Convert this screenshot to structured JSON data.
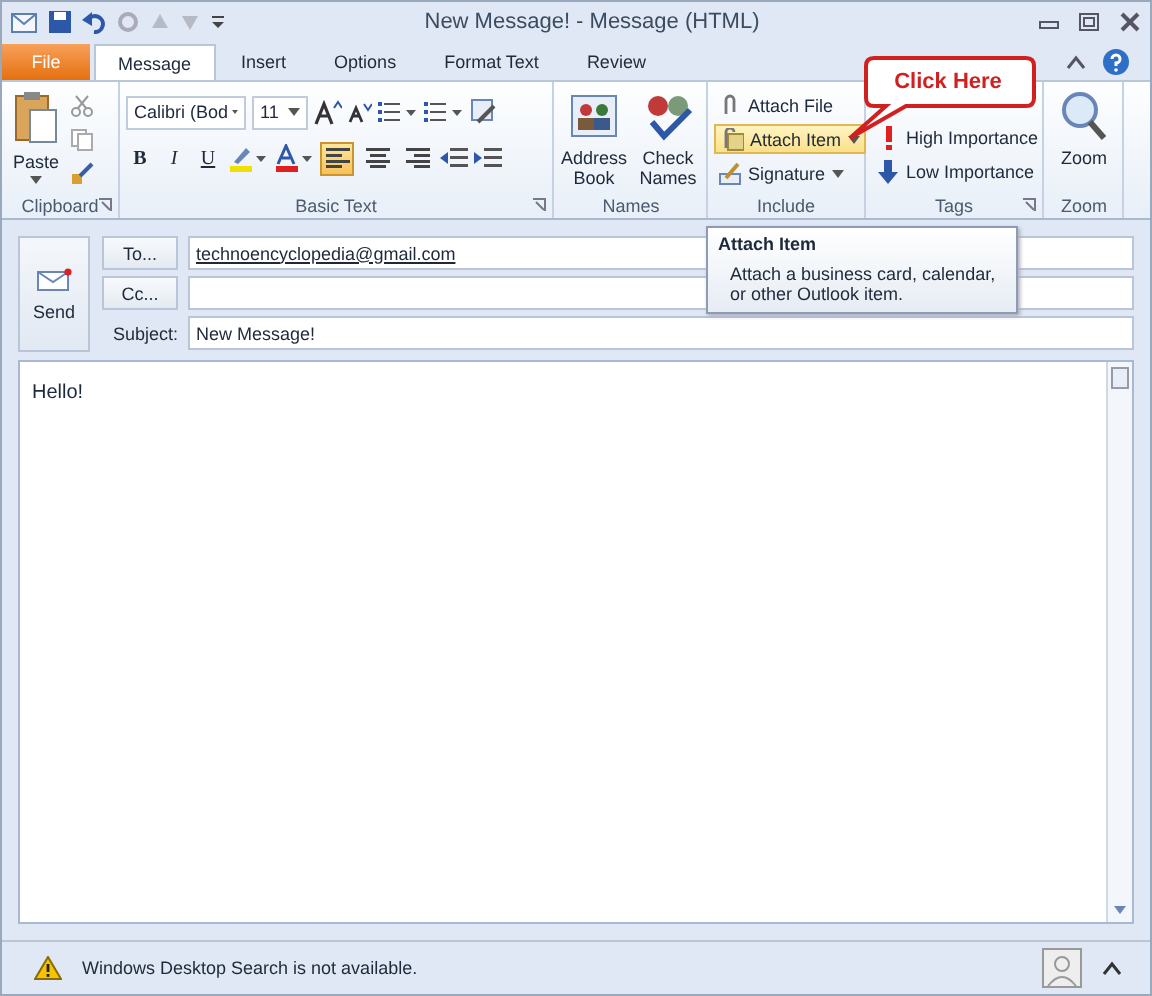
{
  "window": {
    "title": "New Message! - Message (HTML)"
  },
  "tabs": [
    {
      "label": "File",
      "kind": "file",
      "selected": false
    },
    {
      "label": "Message",
      "kind": "tab",
      "selected": true
    },
    {
      "label": "Insert",
      "kind": "tab",
      "selected": false
    },
    {
      "label": "Options",
      "kind": "tab",
      "selected": false
    },
    {
      "label": "Format Text",
      "kind": "tab",
      "selected": false
    },
    {
      "label": "Review",
      "kind": "tab",
      "selected": false
    }
  ],
  "ribbon": {
    "groups": [
      {
        "kind": "clipboard",
        "label": "Clipboard",
        "launcher": true,
        "items": [
          {
            "label": "Paste"
          }
        ]
      },
      {
        "kind": "basic_text",
        "label": "Basic Text",
        "launcher": true,
        "font": "Calibri (Bod",
        "size": "11",
        "formats": [
          "B",
          "I",
          "U"
        ],
        "align": [
          {
            "selected": true
          },
          {
            "selected": false
          },
          {
            "selected": false
          }
        ]
      },
      {
        "kind": "large",
        "label": "Names",
        "launcher": false,
        "items": [
          {
            "label": "Address Book"
          },
          {
            "label": "Check Names"
          }
        ]
      },
      {
        "kind": "small",
        "label": "Include",
        "launcher": false,
        "items": [
          {
            "label": "Attach File",
            "dropdown": false,
            "selected": false
          },
          {
            "label": "Attach Item",
            "dropdown": true,
            "selected": true
          },
          {
            "label": "Signature",
            "dropdown": true,
            "selected": false
          }
        ]
      },
      {
        "kind": "small",
        "label": "Tags",
        "launcher": true,
        "items": [
          {
            "label": "High Importance",
            "dropdown": false,
            "selected": false
          },
          {
            "label": "Low Importance",
            "dropdown": false,
            "selected": false
          }
        ]
      },
      {
        "kind": "large",
        "label": "Zoom",
        "launcher": false,
        "items": [
          {
            "label": "Zoom"
          }
        ]
      }
    ]
  },
  "callout": {
    "text": "Click Here"
  },
  "tooltip": {
    "title": "Attach Item",
    "text": "Attach a business card, calendar, or other Outlook item."
  },
  "form": {
    "send": "Send",
    "rows": [
      {
        "kind": "button",
        "label": "To...",
        "value": "technoencyclopedia@gmail.com",
        "resolved": true
      },
      {
        "kind": "button",
        "label": "Cc..."
      },
      {
        "kind": "label",
        "label": "Subject:",
        "value": "New Message!",
        "resolved": false
      }
    ]
  },
  "body": {
    "text": "Hello!"
  },
  "status_bar": {
    "text": "Windows Desktop Search is not available."
  }
}
